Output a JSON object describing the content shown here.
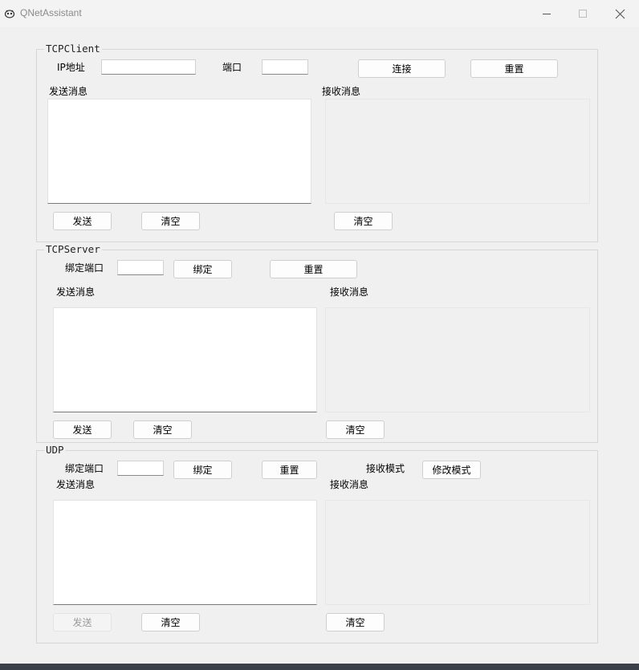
{
  "window": {
    "title": "QNetAssistant",
    "controls": {
      "minimize": "minimize-icon",
      "maximize": "maximize-icon",
      "close": "close-icon"
    }
  },
  "tcp_client": {
    "title": "TCPClient",
    "ip_label": "IP地址",
    "ip_value": "",
    "port_label": "端口",
    "port_value": "",
    "connect_btn": "连接",
    "reset_btn": "重置",
    "send_label": "发送消息",
    "recv_label": "接收消息",
    "send_text": "",
    "recv_text": "",
    "send_btn": "发送",
    "clear_send_btn": "清空",
    "clear_recv_btn": "清空"
  },
  "tcp_server": {
    "title": "TCPServer",
    "bind_port_label": "绑定端口",
    "bind_port_value": "",
    "bind_btn": "绑定",
    "reset_btn": "重置",
    "send_label": "发送消息",
    "recv_label": "接收消息",
    "send_text": "",
    "recv_text": "",
    "send_btn": "发送",
    "clear_send_btn": "清空",
    "clear_recv_btn": "清空"
  },
  "udp": {
    "title": "UDP",
    "bind_port_label": "绑定端口",
    "bind_port_value": "",
    "bind_btn": "绑定",
    "reset_btn": "重置",
    "recv_mode_label": "接收模式",
    "change_mode_btn": "修改模式",
    "send_label": "发送消息",
    "recv_label": "接收消息",
    "send_text": "",
    "recv_text": "",
    "send_btn": "发送",
    "send_btn_disabled": true,
    "clear_send_btn": "清空",
    "clear_recv_btn": "清空"
  }
}
